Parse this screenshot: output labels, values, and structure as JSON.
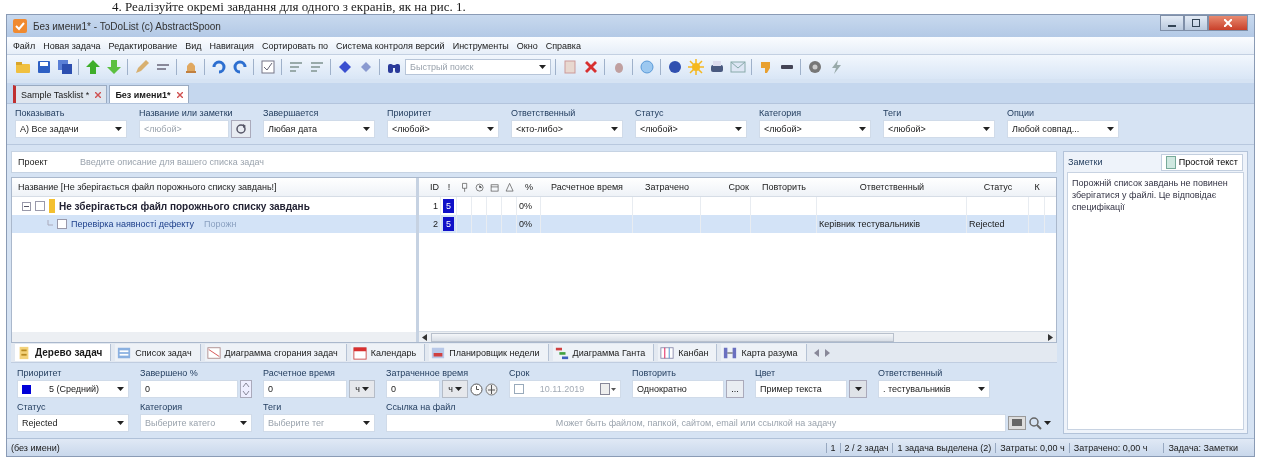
{
  "document_text": "4. Реалізуйте окремі завдання для одного з екранів, як на рис. 1.",
  "window": {
    "title": "Без имени1* - ToDoList (c) AbstractSpoon"
  },
  "menu": [
    "Файл",
    "Новая задача",
    "Редактирование",
    "Вид",
    "Навигация",
    "Сортировать по",
    "Система контроля версий",
    "Инструменты",
    "Окно",
    "Справка"
  ],
  "toolbar": {
    "search_placeholder": "Быстрый поиск"
  },
  "tasklist_tabs": [
    {
      "label": "Sample Tasklist *",
      "selected": false
    },
    {
      "label": "Без имени1*",
      "selected": true
    }
  ],
  "filters": [
    {
      "kind": "combo",
      "label": "Показывать",
      "value": "A) Все задачи"
    },
    {
      "kind": "text",
      "label": "Название или заметки",
      "placeholder": "<любой>"
    },
    {
      "kind": "combo",
      "label": "Завершается",
      "value": "Любая дата"
    },
    {
      "kind": "combo",
      "label": "Приоритет",
      "value": "<любой>"
    },
    {
      "kind": "combo",
      "label": "Ответственный",
      "value": "<кто-либо>"
    },
    {
      "kind": "combo",
      "label": "Статус",
      "value": "<любой>"
    },
    {
      "kind": "combo",
      "label": "Категория",
      "value": "<любой>"
    },
    {
      "kind": "combo",
      "label": "Теги",
      "value": "<любой>"
    },
    {
      "kind": "combo",
      "label": "Опции",
      "value": "Любой совпад..."
    }
  ],
  "project": {
    "label": "Проект",
    "placeholder": "Введите описание для вашего списка задач"
  },
  "tree": {
    "header": "Название [Не зберігається файл порожнього списку завдань!]"
  },
  "list": {
    "columns": [
      {
        "kind": "text",
        "label": "ID"
      },
      {
        "kind": "text",
        "label": "!"
      },
      {
        "kind": "icon"
      },
      {
        "kind": "icon"
      },
      {
        "kind": "icon"
      },
      {
        "kind": "icon"
      },
      {
        "kind": "text",
        "label": "%"
      },
      {
        "kind": "text",
        "label": "Расчетное время"
      },
      {
        "kind": "text",
        "label": "Затрачено"
      },
      {
        "kind": "text",
        "label": "Срок"
      },
      {
        "kind": "text",
        "label": "Повторить"
      },
      {
        "kind": "text",
        "label": "Ответственный"
      },
      {
        "kind": "text",
        "label": "Статус"
      },
      {
        "kind": "text",
        "label": "К"
      }
    ]
  },
  "tasks": [
    {
      "title": "Не зберігається файл порожнього списку завдань",
      "expanded": true,
      "selected": false,
      "checked": false,
      "id": "1",
      "priority": "5",
      "percent": "0%",
      "children": [
        {
          "title": "Перевірка наявності дефекту",
          "comment": "Порожн",
          "selected": true,
          "checked": false,
          "id": "2",
          "priority": "5",
          "percent": "0%",
          "assigned": "Керівник тестувальників",
          "status": "Rejected"
        }
      ]
    }
  ],
  "view_tabs": [
    {
      "label": "Дерево задач",
      "selected": true
    },
    {
      "label": "Список задач",
      "selected": false
    },
    {
      "label": "Диаграмма сгорания задач",
      "selected": false
    },
    {
      "label": "Календарь",
      "selected": false
    },
    {
      "label": "Планировщик недели",
      "selected": false
    },
    {
      "label": "Диаграмма Ганта",
      "selected": false
    },
    {
      "label": "Канбан",
      "selected": false
    },
    {
      "label": "Карта разума",
      "selected": false
    }
  ],
  "editor": [
    [
      {
        "kind": "priority",
        "label": "Приоритет",
        "value": "5 (Средний)"
      },
      {
        "kind": "spin",
        "label": "Завершено %",
        "value": "0"
      },
      {
        "kind": "time",
        "label": "Расчетное время",
        "value": "0",
        "unit": "ч"
      },
      {
        "kind": "timer",
        "label": "Затраченное время",
        "value": "0",
        "unit": "ч"
      },
      {
        "kind": "date",
        "label": "Срок",
        "value": "10.11.2019",
        "checked": false
      },
      {
        "kind": "repeat",
        "label": "Повторить",
        "value": "Однократно",
        "button": "..."
      },
      {
        "kind": "color",
        "label": "Цвет",
        "value": "Пример текста"
      },
      {
        "kind": "combo",
        "label": "Ответственный",
        "value": ". тестувальників"
      }
    ],
    [
      {
        "kind": "combo",
        "label": "Статус",
        "value": "Rejected"
      },
      {
        "kind": "combo",
        "label": "Категория",
        "placeholder": "Выберите катего"
      },
      {
        "kind": "combo",
        "label": "Теги",
        "placeholder": "Выберите тег"
      },
      {
        "kind": "link",
        "label": "Ссылка на файл",
        "placeholder": "Может быть файлом, папкой, сайтом, email или ссылкой на задачу"
      }
    ]
  ],
  "notes": {
    "tab": "Заметки",
    "format": "Простой текст",
    "text": "Порожній список завдань не повинен зберігатися у файлі. Це відповідає специфікації"
  },
  "status_bar": {
    "left": "(без имени)",
    "segments": [
      "1",
      "2 / 2 задач",
      "1 задача выделена (2)",
      "Затраты: 0,00 ч",
      "Затрачено: 0,00 ч"
    ],
    "right": "Задача: Заметки"
  }
}
